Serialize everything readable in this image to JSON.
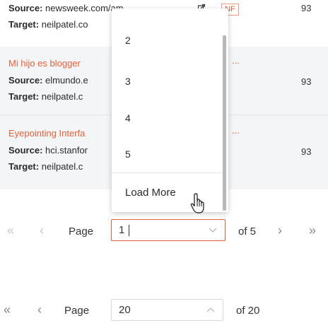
{
  "table": {
    "rows": [
      {
        "title": "",
        "source_label": "Source:",
        "source_value": "newsweek.com/am...",
        "target_label": "Target:",
        "target_value": "neilpatel.co",
        "badge": "NF",
        "score": "93"
      },
      {
        "title": "Mi hijo es blogger",
        "title_suffix": "...",
        "source_label": "Source:",
        "source_value": "elmundo.e",
        "target_label": "Target:",
        "target_value": "neilpatel.c",
        "score": "93"
      },
      {
        "title": "Eyepointing Interfa",
        "title_suffix": "...",
        "source_label": "Source:",
        "source_value": "hci.stanfor",
        "target_label": "Target:",
        "target_value": "neilpatel.c",
        "score": "93"
      }
    ]
  },
  "page_dropdown": {
    "options": [
      "2",
      "3",
      "4",
      "5"
    ],
    "load_more": "Load More"
  },
  "pager_top": {
    "page_label": "Page",
    "current_page": "1",
    "of_label": "of 5"
  },
  "pager_bottom": {
    "page_label": "Page",
    "current_page": "20",
    "of_label": "of 20"
  },
  "colors": {
    "accent": "#e0603a",
    "row_shade": "#f4f5f7"
  }
}
